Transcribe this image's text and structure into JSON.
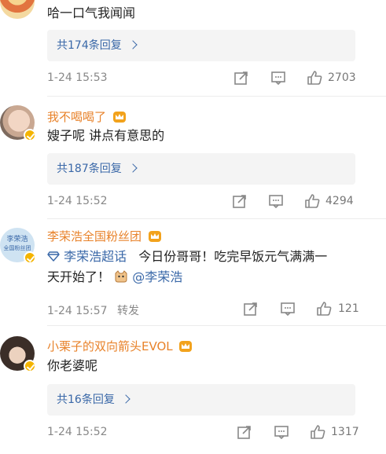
{
  "comments": [
    {
      "text": "哈一口气我闻闻",
      "replies": "共174条回复",
      "time": "1-24 15:53",
      "likes": "2703"
    },
    {
      "name": "我不喝喝了",
      "text": "嫂子呢 讲点有意思的",
      "replies": "共187条回复",
      "time": "1-24 15:52",
      "likes": "4294"
    },
    {
      "name": "李荣浩全国粉丝团",
      "avatar_text": "李荣浩",
      "avatar_sub": "全国粉丝团",
      "supertopic": "李荣浩超话",
      "text1": "今日份哥哥！吃完早饭元气满满一",
      "text2": "天开始了！",
      "mention": "@李荣浩",
      "time": "1-24 15:57",
      "repost": "转发",
      "likes": "121"
    },
    {
      "name": "小栗子的双向箭头EVOL",
      "text": "你老婆呢",
      "replies": "共16条回复",
      "time": "1-24 15:52",
      "likes": "1317"
    }
  ],
  "colors": {
    "username": "#e8822a",
    "link": "#3a68a8"
  }
}
